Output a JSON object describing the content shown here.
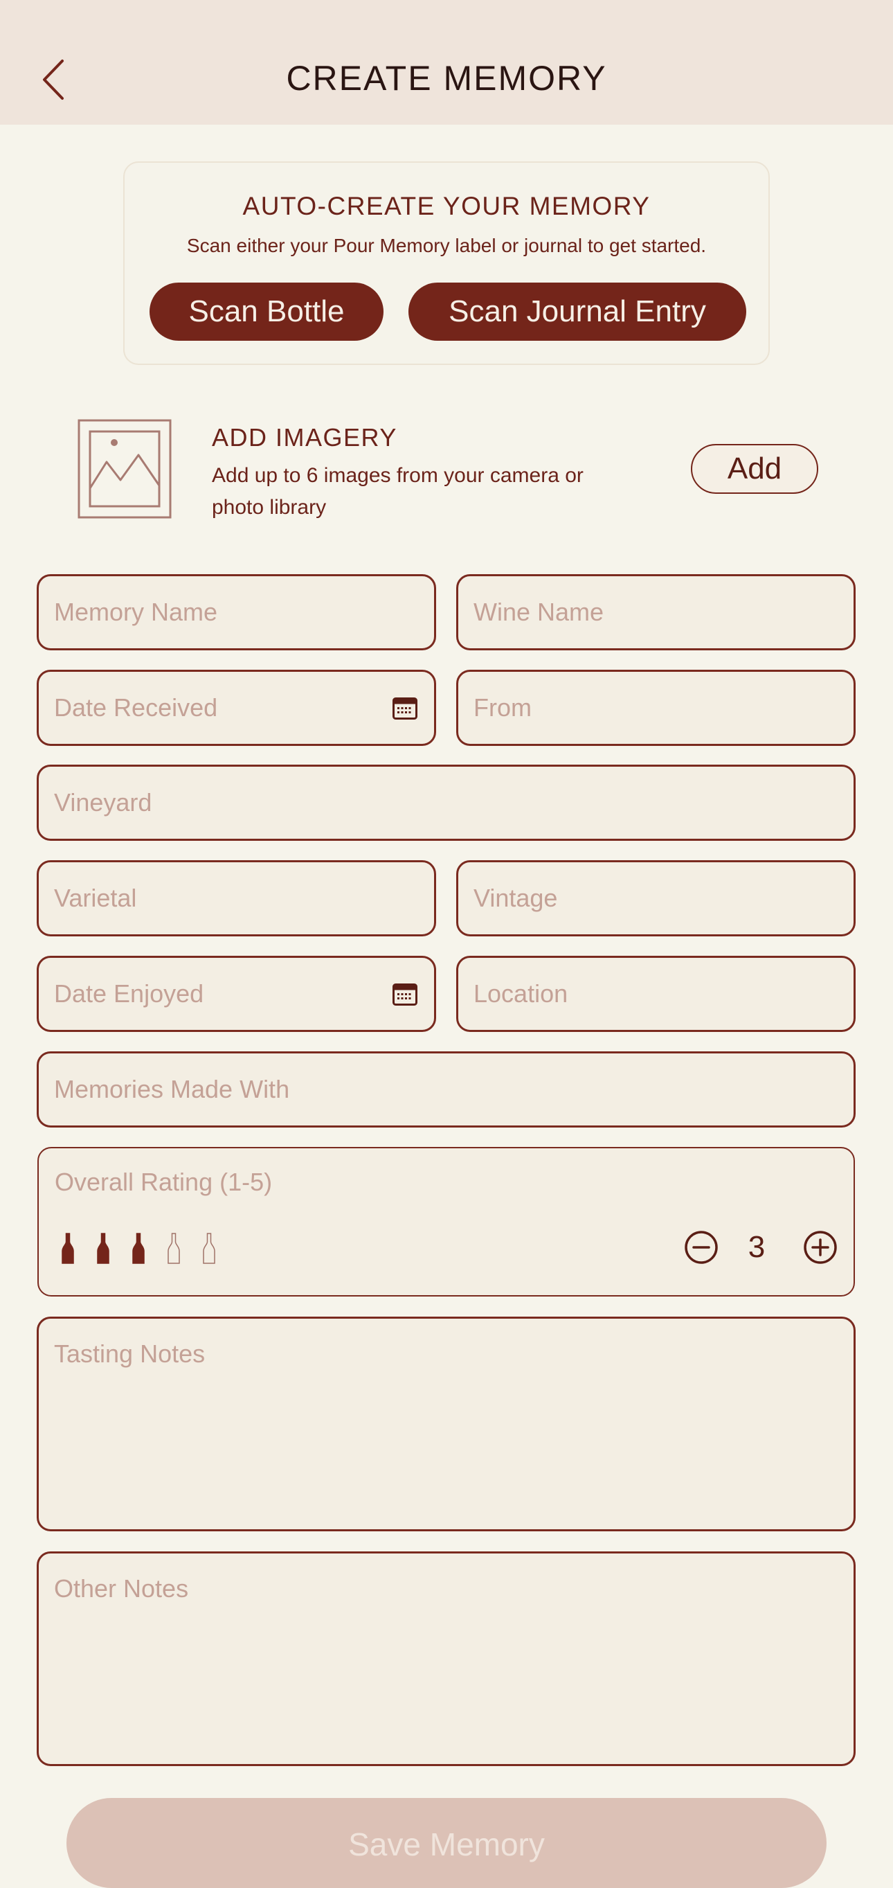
{
  "header": {
    "title": "CREATE MEMORY",
    "back_icon": "chevron-left-icon"
  },
  "auto_create": {
    "title": "AUTO-CREATE YOUR MEMORY",
    "subtitle": "Scan either your Pour Memory label or journal to get started.",
    "scan_bottle_label": "Scan Bottle",
    "scan_journal_label": "Scan Journal Entry"
  },
  "imagery": {
    "icon": "image-placeholder-icon",
    "title": "ADD IMAGERY",
    "subtitle": "Add up to 6 images from your camera or photo library",
    "add_label": "Add"
  },
  "fields": {
    "memory_name": "Memory Name",
    "wine_name": "Wine Name",
    "date_received": "Date Received",
    "from": "From",
    "vineyard": "Vineyard",
    "varietal": "Varietal",
    "vintage": "Vintage",
    "date_enjoyed": "Date Enjoyed",
    "location": "Location",
    "memories_made_with": "Memories Made With",
    "tasting_notes": "Tasting Notes",
    "other_notes": "Other Notes"
  },
  "rating": {
    "label": "Overall Rating (1-5)",
    "value": "3",
    "max": 5,
    "filled_color": "#74251a"
  },
  "colors": {
    "accent": "#74251a",
    "header_bg": "#efe4db",
    "background": "#f6f4eb",
    "placeholder": "#c4a196",
    "save_disabled": "#dcc1b6"
  },
  "save_label": "Save Memory"
}
